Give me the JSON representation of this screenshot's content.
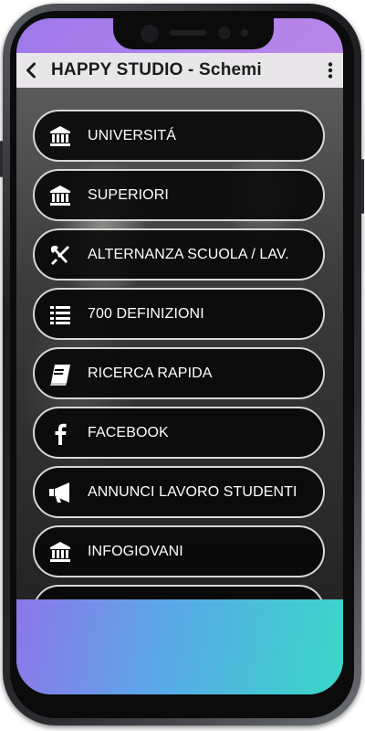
{
  "appbar": {
    "back_icon": "arrow-left-icon",
    "title": "HAPPY STUDIO - Schemi",
    "menu_icon": "kebab-menu-icon"
  },
  "menu": {
    "items": [
      {
        "label": "UNIVERSITÁ",
        "icon": "institution-icon"
      },
      {
        "label": "SUPERIORI",
        "icon": "institution-icon"
      },
      {
        "label": "ALTERNANZA SCUOLA / LAV.",
        "icon": "tools-icon"
      },
      {
        "label": "700 DEFINIZIONI",
        "icon": "list-icon"
      },
      {
        "label": "RICERCA RAPIDA",
        "icon": "book-icon"
      },
      {
        "label": "FACEBOOK",
        "icon": "facebook-icon"
      },
      {
        "label": "ANNUNCI LAVORO STUDENTI",
        "icon": "megaphone-icon"
      },
      {
        "label": "INFOGIOVANI",
        "icon": "institution-icon"
      }
    ]
  },
  "colors": {
    "appbar_bg": "#e9e6ea",
    "button_bg": "#080808",
    "button_border": "#d8d8d8",
    "bottom_gradient": [
      "#8c78e8",
      "#5aa8e8",
      "#39d8c8"
    ]
  }
}
